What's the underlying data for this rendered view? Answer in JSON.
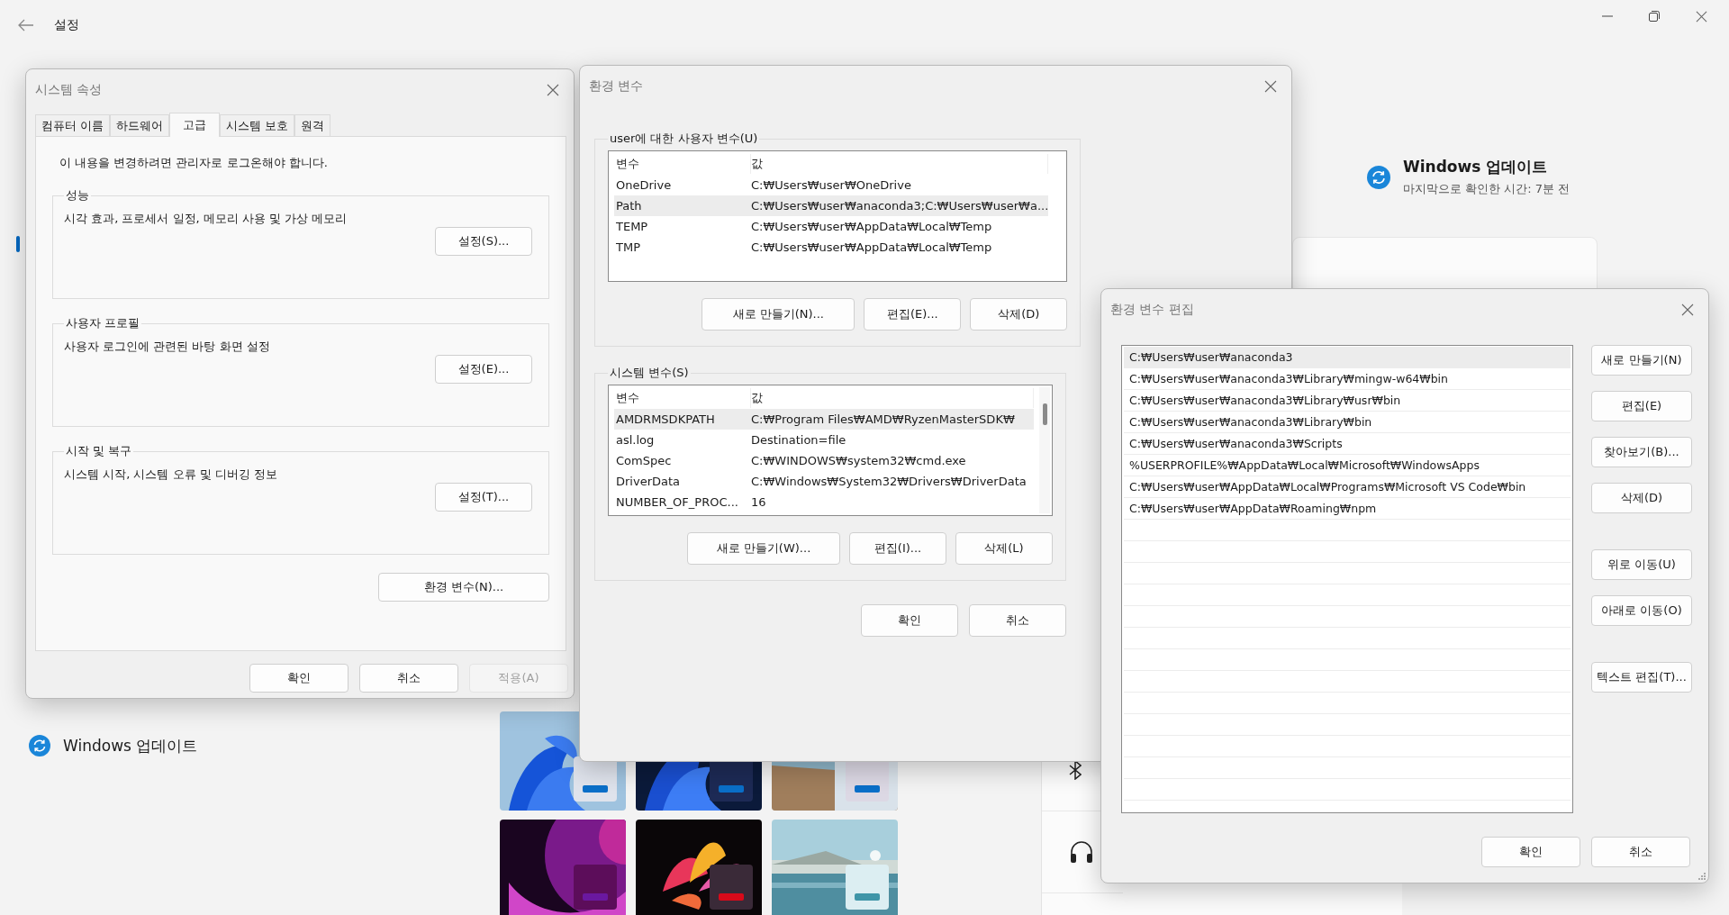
{
  "settings": {
    "title": "설정",
    "nav_items": [
      {
        "label": "Windows 업데이트"
      }
    ],
    "update": {
      "title": "Windows 업데이트",
      "subtitle": "마지막으로 확인한 시간: 7분 전"
    }
  },
  "system_properties": {
    "title": "시스템 속성",
    "tabs": [
      {
        "label": "컴퓨터 이름",
        "selected": false
      },
      {
        "label": "하드웨어",
        "selected": false
      },
      {
        "label": "고급",
        "selected": true
      },
      {
        "label": "시스템 보호",
        "selected": false
      },
      {
        "label": "원격",
        "selected": false
      }
    ],
    "notice": "이 내용을 변경하려면 관리자로 로그온해야 합니다.",
    "groups": [
      {
        "legend": "성능",
        "description": "시각 효과, 프로세서 일정, 메모리 사용 및 가상 메모리",
        "button": "설정(S)..."
      },
      {
        "legend": "사용자 프로필",
        "description": "사용자 로그인에 관련된 바탕 화면 설정",
        "button": "설정(E)..."
      },
      {
        "legend": "시작 및 복구",
        "description": "시스템 시작, 시스템 오류 및 디버깅 정보",
        "button": "설정(T)..."
      }
    ],
    "env_button": "환경 변수(N)...",
    "buttons": [
      {
        "label": "확인",
        "disabled": false
      },
      {
        "label": "취소",
        "disabled": false
      },
      {
        "label": "적용(A)",
        "disabled": true
      }
    ]
  },
  "environment_variables": {
    "title": "환경 변수",
    "sections": [
      {
        "legend": "user에 대한 사용자 변수(U)",
        "columns": [
          "변수",
          "값"
        ],
        "rows": [
          {
            "name": "OneDrive",
            "value": "C:₩Users₩user₩OneDrive",
            "selected": false
          },
          {
            "name": "Path",
            "value": "C:₩Users₩user₩anaconda3;C:₩Users₩user₩a...",
            "selected": true
          },
          {
            "name": "TEMP",
            "value": "C:₩Users₩user₩AppData₩Local₩Temp",
            "selected": false
          },
          {
            "name": "TMP",
            "value": "C:₩Users₩user₩AppData₩Local₩Temp",
            "selected": false
          }
        ],
        "scrollbar": false,
        "buttons": [
          "새로 만들기(N)...",
          "편집(E)...",
          "삭제(D)"
        ]
      },
      {
        "legend": "시스템 변수(S)",
        "columns": [
          "변수",
          "값"
        ],
        "rows": [
          {
            "name": "AMDRMSDKPATH",
            "value": "C:₩Program Files₩AMD₩RyzenMasterSDK₩",
            "selected": true
          },
          {
            "name": "asl.log",
            "value": "Destination=file",
            "selected": false
          },
          {
            "name": "ComSpec",
            "value": "C:₩WINDOWS₩system32₩cmd.exe",
            "selected": false
          },
          {
            "name": "DriverData",
            "value": "C:₩Windows₩System32₩Drivers₩DriverData",
            "selected": false
          },
          {
            "name": "NUMBER_OF_PROC...",
            "value": "16",
            "selected": false
          }
        ],
        "scrollbar": true,
        "buttons": [
          "새로 만들기(W)...",
          "편집(I)...",
          "삭제(L)"
        ]
      }
    ],
    "buttons": [
      "확인",
      "취소"
    ]
  },
  "edit_variable": {
    "title": "환경 변수 편집",
    "entries": [
      {
        "text": "C:₩Users₩user₩anaconda3",
        "selected": true
      },
      {
        "text": "C:₩Users₩user₩anaconda3₩Library₩mingw-w64₩bin",
        "selected": false
      },
      {
        "text": "C:₩Users₩user₩anaconda3₩Library₩usr₩bin",
        "selected": false
      },
      {
        "text": "C:₩Users₩user₩anaconda3₩Library₩bin",
        "selected": false
      },
      {
        "text": "C:₩Users₩user₩anaconda3₩Scripts",
        "selected": false
      },
      {
        "text": "%USERPROFILE%₩AppData₩Local₩Microsoft₩WindowsApps",
        "selected": false
      },
      {
        "text": "C:₩Users₩user₩AppData₩Local₩Programs₩Microsoft VS Code₩bin",
        "selected": false
      },
      {
        "text": "C:₩Users₩user₩AppData₩Roaming₩npm",
        "selected": false
      }
    ],
    "side_button_groups": [
      [
        "새로 만들기(N)",
        "편집(E)",
        "찾아보기(B)...",
        "삭제(D)"
      ],
      [
        "위로 이동(U)",
        "아래로 이동(O)"
      ],
      [
        "텍스트 편집(T)..."
      ]
    ],
    "buttons": [
      "확인",
      "취소"
    ]
  }
}
